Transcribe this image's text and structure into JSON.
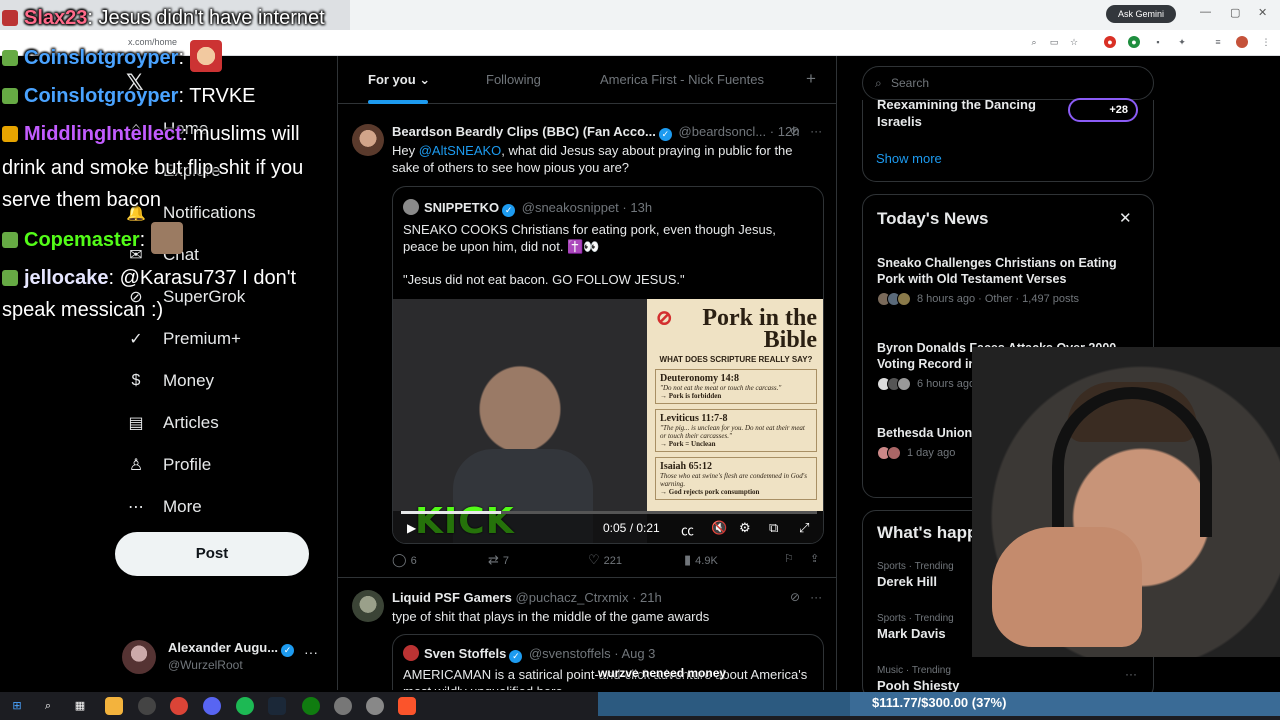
{
  "browser": {
    "url": "x.com/home",
    "ask_gemini": "Ask Gemini"
  },
  "nav": {
    "items": [
      {
        "label": "Home",
        "icon": "home-icon"
      },
      {
        "label": "Explore",
        "icon": "search-icon"
      },
      {
        "label": "Notifications",
        "icon": "bell-icon"
      },
      {
        "label": "Chat",
        "icon": "chat-icon"
      },
      {
        "label": "SuperGrok",
        "icon": "grok-icon"
      },
      {
        "label": "Premium+",
        "icon": "verified-icon"
      },
      {
        "label": "Money",
        "icon": "money-icon"
      },
      {
        "label": "Articles",
        "icon": "articles-icon"
      },
      {
        "label": "Profile",
        "icon": "profile-icon"
      },
      {
        "label": "More",
        "icon": "more-icon"
      }
    ],
    "post_label": "Post",
    "account": {
      "name": "Alexander Augu...",
      "handle": "@WurzelRoot"
    }
  },
  "timeline": {
    "tabs": [
      "For you",
      "Following",
      "America First - Nick Fuentes"
    ],
    "tweets": [
      {
        "name": "Beardson Beardly Clips (BBC) (Fan Acco...",
        "handle": "@beardsoncl...",
        "time": "12h",
        "text_before": "Hey ",
        "mention": "@AltSNEAKO",
        "text_after": ", what did Jesus say about praying in public for the sake of others to see how pious you are?",
        "quote": {
          "name": "SNIPPETKO",
          "handle": "@sneakosnippet",
          "time": "13h",
          "text1": "SNEAKO COOKS Christians for eating pork, even though Jesus, peace be upon him, did not. ✝️👀",
          "text2": "\"Jesus did not eat bacon. GO FOLLOW JESUS.\"",
          "video": {
            "time": "0:05 / 0:21",
            "progress": 0.24,
            "kick": "KICK",
            "card": {
              "title": "Pork in the Bible",
              "subtitle": "WHAT DOES SCRIPTURE REALLY SAY?",
              "blocks": [
                {
                  "ref": "Deuteronomy 14:8",
                  "quote": "\"Do not eat the meat or touch the carcass.\"",
                  "note": "→ Pork is forbidden"
                },
                {
                  "ref": "Leviticus 11:7-8",
                  "quote": "\"The pig... is unclean for you. Do not eat their meat or touch their carcasses.\"",
                  "note": "→ Pork = Unclean"
                },
                {
                  "ref": "Isaiah 65:12",
                  "quote": "Those who eat swine's flesh are condemned in God's warning.",
                  "note": "→ God rejects pork consumption"
                }
              ]
            }
          }
        },
        "replies": "6",
        "reposts": "7",
        "likes": "221",
        "views": "4.9K"
      },
      {
        "name": "Liquid PSF Gamers",
        "handle": "@puchacz_Ctrxmix",
        "time": "21h",
        "text": "type of shit that plays in the middle of the game awards",
        "quote": {
          "name": "Sven Stoffels",
          "handle": "@svenstoffels",
          "time": "Aug 3",
          "text": "AMERICAMAN is a satirical point-and-click adventure about America's most wildly unqualified hero"
        }
      }
    ]
  },
  "sidebar": {
    "search_placeholder": "Search",
    "partial_trend": "Reexamining the Dancing Israelis",
    "plus_count": "+28",
    "show_more": "Show more",
    "news": {
      "title": "Today's News",
      "items": [
        {
          "headline": "Sneako Challenges Christians on Eating Pork with Old Testament Verses",
          "meta": "8 hours ago · Other · 1,497 posts"
        },
        {
          "headline": "Byron Donalds Faces Attacks Over 2000 Voting Record in Florida Governor Primary",
          "meta": "6 hours ago · News · 2,299 posts"
        },
        {
          "headline": "Bethesda Union Pr... Sharp Online Back...",
          "meta": "1 day ago"
        }
      ]
    },
    "happening": {
      "title": "What's happ",
      "trends": [
        {
          "category": "Sports · Trending",
          "name": "Derek Hill"
        },
        {
          "category": "Sports · Trending",
          "name": "Mark Davis"
        },
        {
          "category": "Music · Trending",
          "name": "Pooh Shiesty"
        }
      ]
    }
  },
  "chat": {
    "lines": [
      {
        "user": "Slax23",
        "msg": ": Jesus didn't have internet",
        "color": "#ff6a8a"
      },
      {
        "user": "Coinslotgroyper",
        "msg": ":",
        "color": "#4aa3ff"
      },
      {
        "user": "Coinslotgroyper",
        "msg": ": TRVKE",
        "color": "#4aa3ff"
      },
      {
        "user": "MiddlingIntellect",
        "msg": ": muslims will",
        "color": "#c25cff"
      },
      {
        "user": "",
        "msg": "drink and smoke but flip shit if you",
        "color": "#ffffff"
      },
      {
        "user": "",
        "msg": "serve them bacon",
        "color": "#ffffff"
      },
      {
        "user": "Copemaster",
        "msg": ":",
        "color": "#53fc18"
      },
      {
        "user": "jellocake",
        "msg": ": @Karasu737 I don't",
        "color": "#e6e6ff"
      },
      {
        "user": "",
        "msg": "speak messican :)",
        "color": "#ffffff"
      }
    ],
    "subtitle": "wurzve neneed money"
  },
  "goal": {
    "text": "$111.77/$300.00 (37%)",
    "progress": 0.37
  },
  "colors": {
    "accent": "#1d9bf0",
    "kick_green": "#53fc18",
    "premium_purple": "#8b5cf6"
  }
}
